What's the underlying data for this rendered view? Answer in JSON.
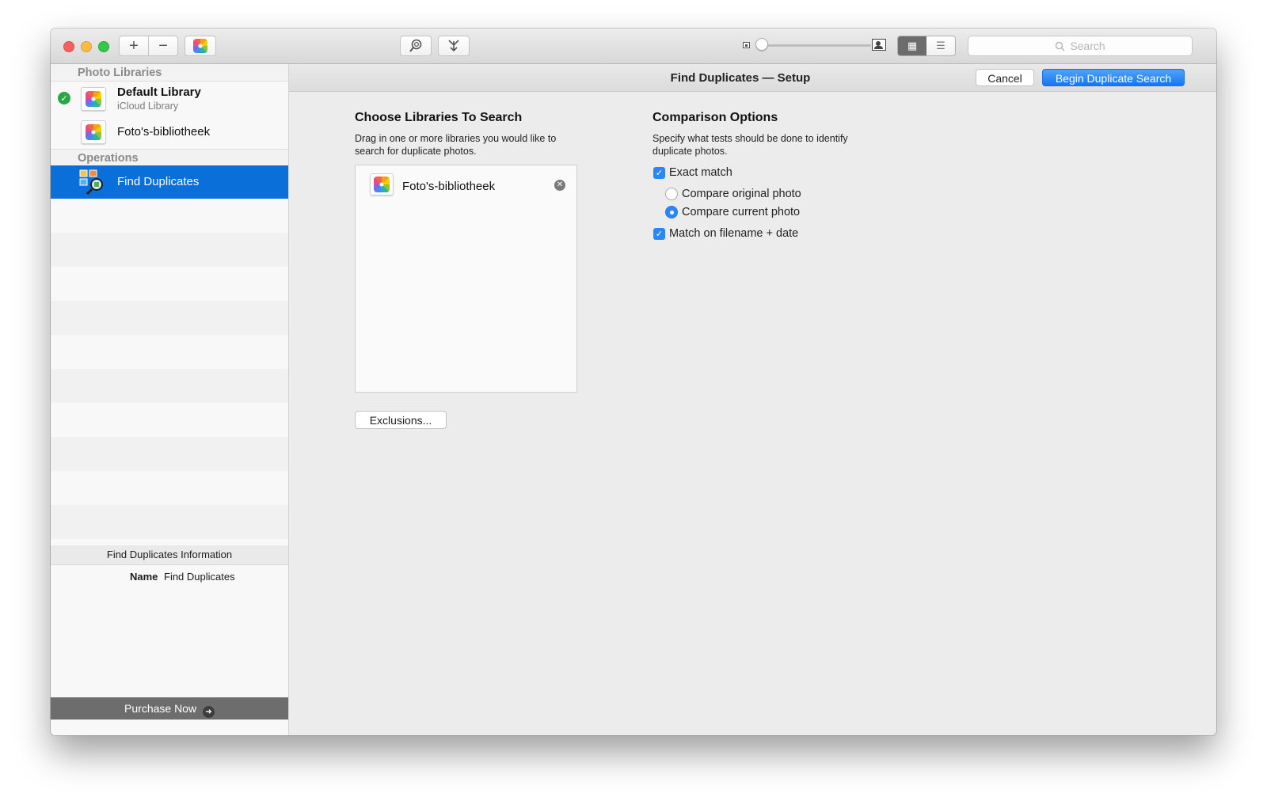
{
  "toolbar": {
    "add_label": "+",
    "remove_label": "−",
    "search_placeholder": "Search",
    "icons": [
      "add-icon",
      "remove-icon",
      "photos-icon",
      "magnifier-icon",
      "import-icon",
      "small-photo-icon",
      "large-photo-icon",
      "grid-view-icon",
      "list-view-icon",
      "search-icon"
    ]
  },
  "sidebar": {
    "photo_libraries_header": "Photo Libraries",
    "libraries": [
      {
        "name": "Default Library",
        "subtitle": "iCloud Library",
        "checked": true
      },
      {
        "name": "Foto's-bibliotheek",
        "subtitle": "",
        "checked": false
      }
    ],
    "operations_header": "Operations",
    "operations": [
      {
        "name": "Find Duplicates",
        "selected": true
      }
    ],
    "info_header": "Find Duplicates Information",
    "info_name_key": "Name",
    "info_name_value": "Find Duplicates",
    "purchase_label": "Purchase Now"
  },
  "main": {
    "title": "Find Duplicates — Setup",
    "cancel_label": "Cancel",
    "begin_label": "Begin Duplicate Search",
    "libraries_heading": "Choose Libraries To Search",
    "libraries_desc_line1": "Drag in one or more libraries you would like to",
    "libraries_desc_line2": "search for duplicate photos.",
    "selected_library": "Foto's-bibliotheek",
    "exclusions_label": "Exclusions...",
    "comparison_heading": "Comparison Options",
    "comparison_desc_line1": "Specify what tests should be done to identify",
    "comparison_desc_line2": "duplicate photos.",
    "exact_match_label": "Exact match",
    "exact_match_checked": true,
    "compare_original_label": "Compare original photo",
    "compare_current_label": "Compare current photo",
    "selected_compare": "Compare current photo",
    "filename_date_label": "Match on filename + date",
    "filename_date_checked": true
  },
  "colors": {
    "selection_blue": "#0a6fd8",
    "accent_blue": "#2c86f5",
    "check_green": "#2aa744"
  }
}
